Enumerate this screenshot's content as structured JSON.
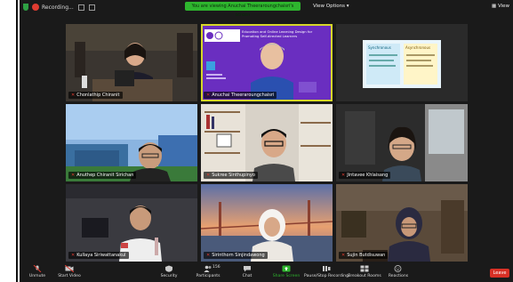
{
  "topbar": {
    "recording_label": "Recording...",
    "sharing_banner": "You are viewing Anuchai Theeraroungchaisri's screen",
    "view_options": "View Options",
    "view_label": "View"
  },
  "tiles": [
    {
      "name": "Chonlathip Chiranit"
    },
    {
      "name": "Anuchai Theeraroungchaisri"
    },
    {
      "name": ""
    },
    {
      "name": "Anuthep Chiranit Sirichan"
    },
    {
      "name": "Sukree Sinthupinyo"
    },
    {
      "name": "Jintavee Khlaisang"
    },
    {
      "name": "Kullaya Siriwattanakul"
    },
    {
      "name": "Sirinthorn Sinjindawong"
    },
    {
      "name": "Sujin Butdisuwan"
    }
  ],
  "slides": {
    "main_title": "Education and Online Learning Design for Promoting Self-directed Learners",
    "side_left": "Synchronous",
    "side_right": "Asynchronous"
  },
  "controls": {
    "unmute": "Unmute",
    "start_video": "Start Video",
    "security": "Security",
    "participants": "Participants",
    "participants_count": "156",
    "chat": "Chat",
    "share_screen": "Share Screen",
    "pause_recording": "Pause/Stop Recording",
    "breakout_rooms": "Breakout Rooms",
    "reactions": "Reactions",
    "leave": "Leave"
  },
  "colors": {
    "accent_green": "#2eb52e",
    "active_speaker": "#d6d62a",
    "leave_red": "#d93025",
    "slide_purple": "#6a2ec0"
  }
}
